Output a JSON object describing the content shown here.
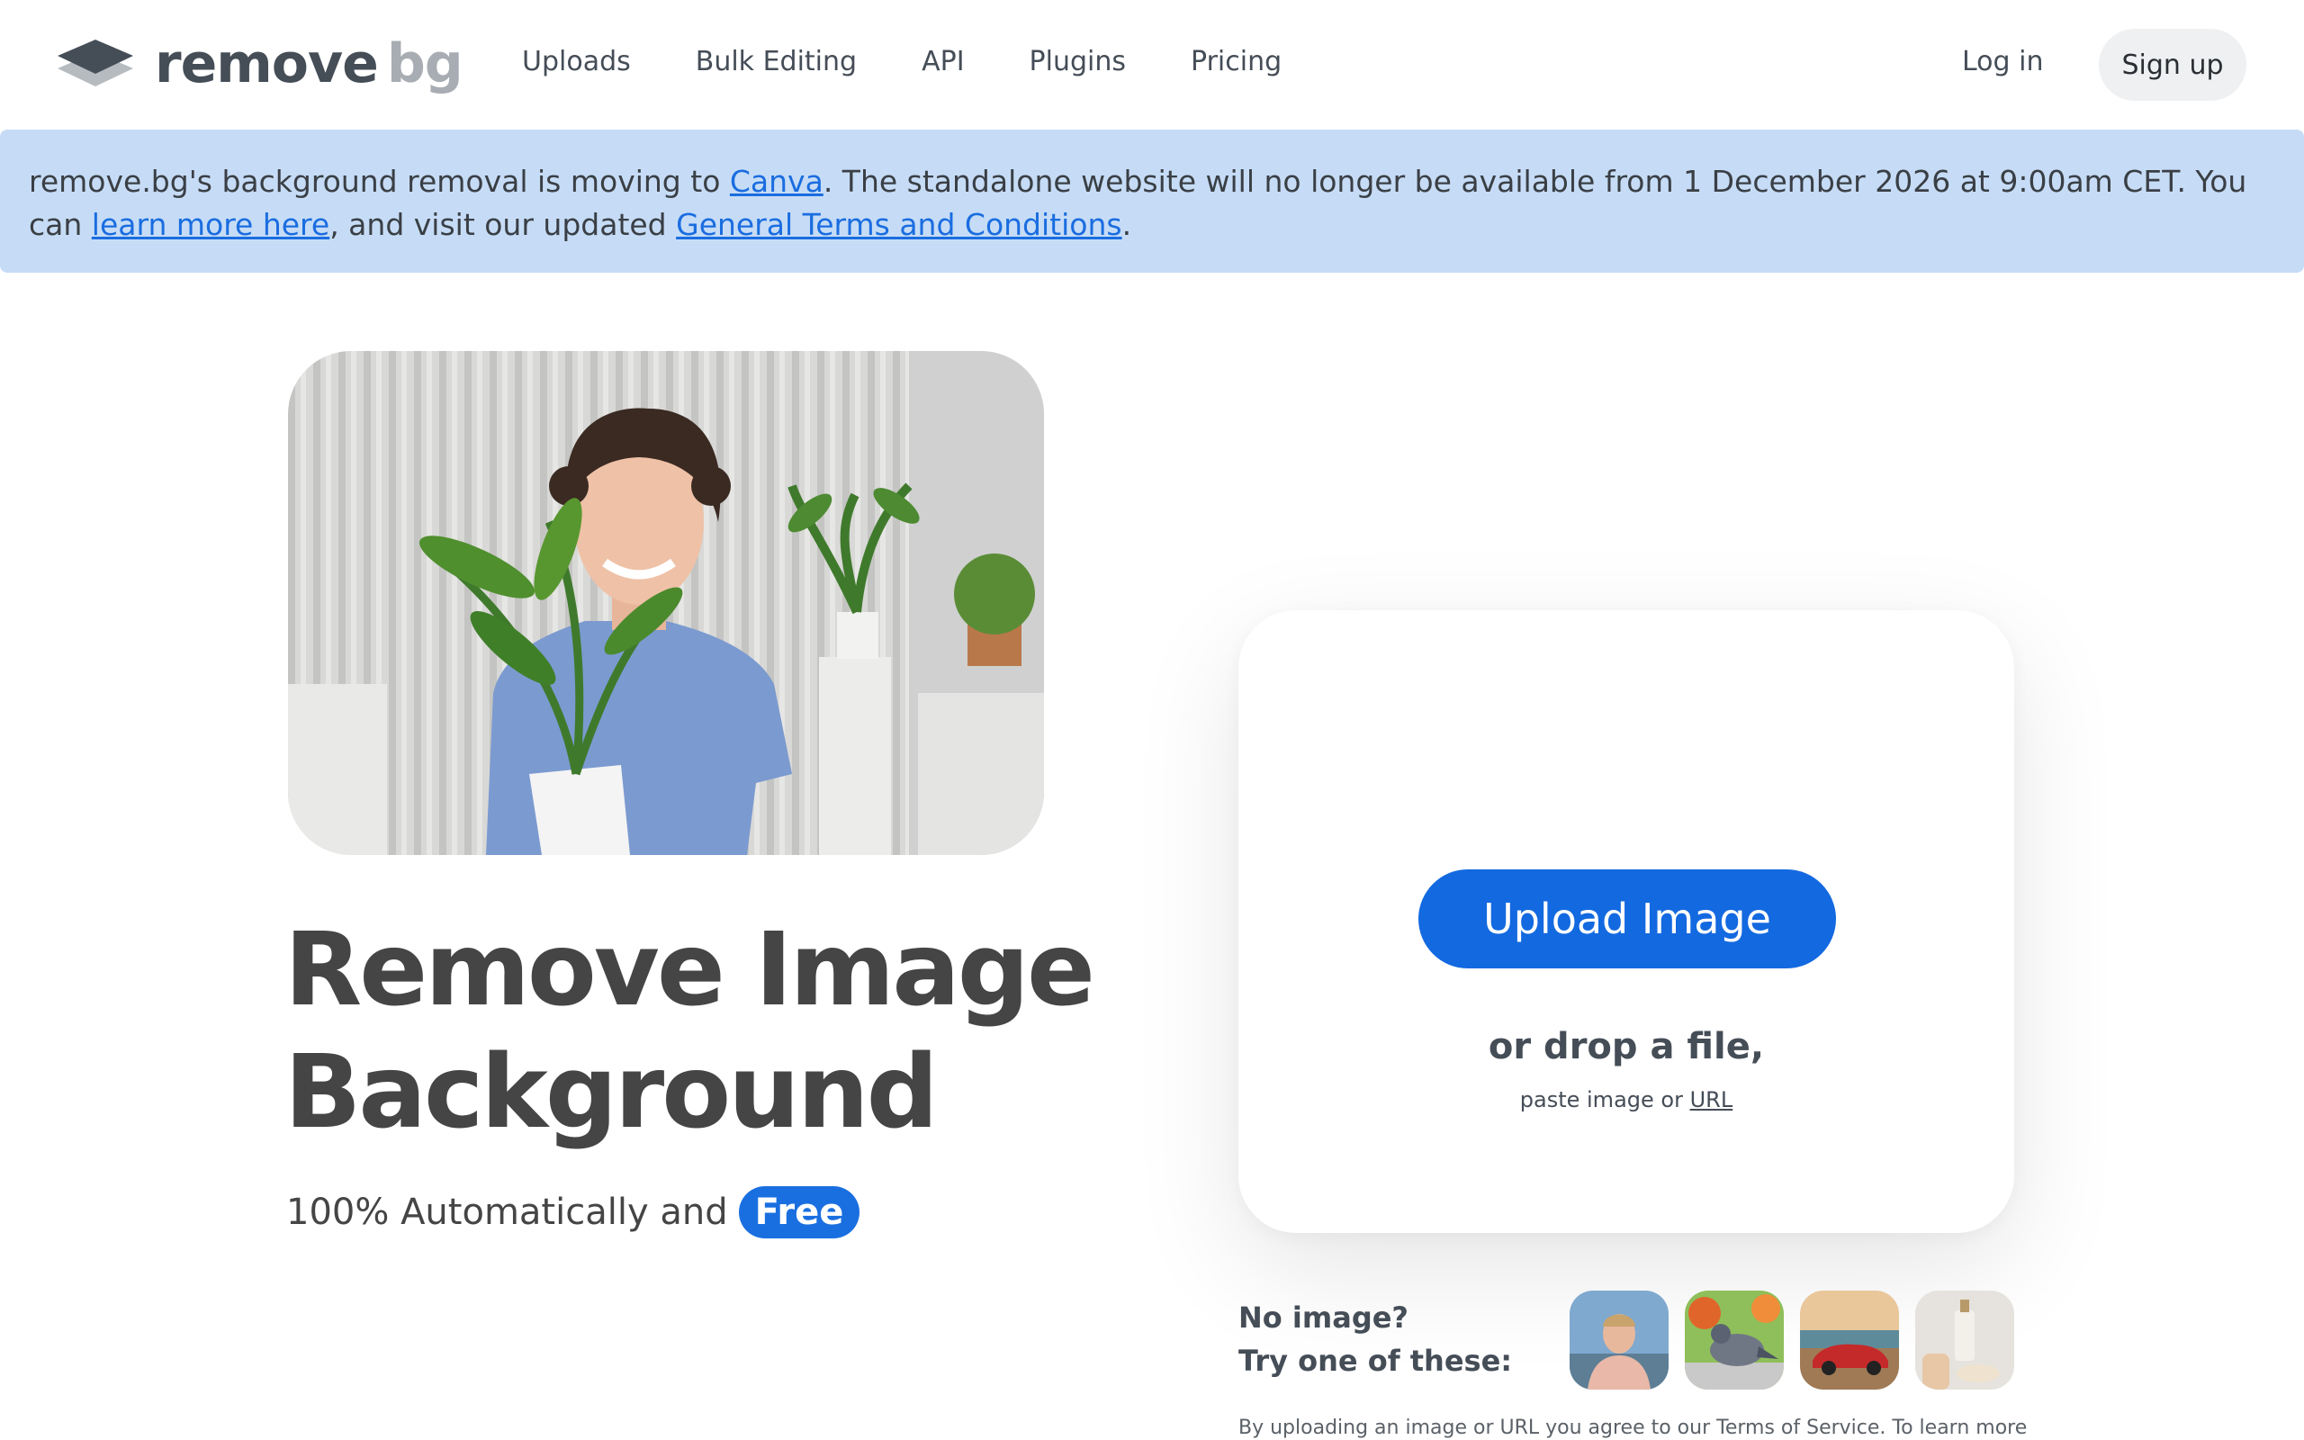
{
  "brand": {
    "word1": "remove",
    "word2": "bg"
  },
  "nav": {
    "links": [
      "Uploads",
      "Bulk Editing",
      "API",
      "Plugins",
      "Pricing"
    ],
    "login": "Log in",
    "signup": "Sign up"
  },
  "banner": {
    "t1": "remove.bg's background removal is moving to ",
    "link_canva": "Canva",
    "t2": ". The standalone website will no longer be available from 1 December 2026 at 9:00am CET. You can ",
    "link_learn": "learn more here",
    "t3": ", and visit our updated ",
    "link_terms": "General Terms and Conditions",
    "t4": "."
  },
  "hero": {
    "headline_line1": "Remove Image",
    "headline_line2": "Background",
    "sub_text": "100% Automatically and",
    "free_badge": "Free"
  },
  "upload": {
    "button": "Upload Image",
    "drop_text": "or drop a file,",
    "paste_text": "paste image or",
    "url_link": "URL"
  },
  "samples": {
    "line1": "No image?",
    "line2": "Try one of these:",
    "thumbs": [
      "person-thumbnail",
      "pigeon-thumbnail",
      "car-thumbnail",
      "cosmetics-thumbnail"
    ]
  },
  "legal": "By uploading an image or URL you agree to our Terms of Service. To learn more",
  "colors": {
    "accent": "#1369e0",
    "banner_bg": "#c6dcf6",
    "text": "#454545"
  }
}
